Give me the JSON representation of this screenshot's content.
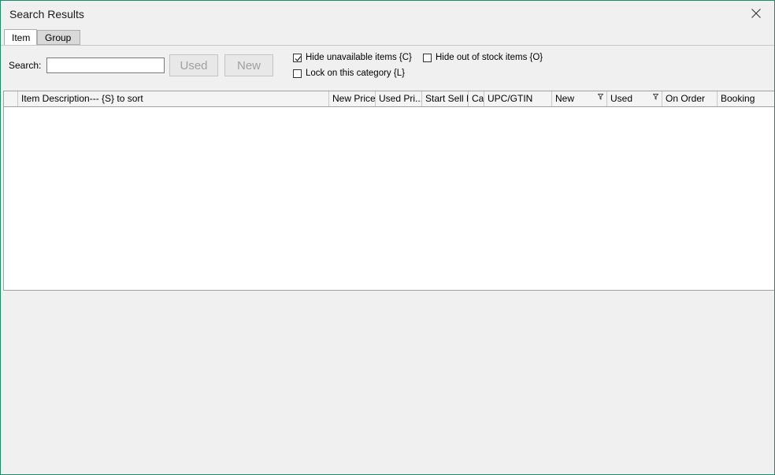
{
  "window": {
    "title": "Search Results"
  },
  "tabs": [
    {
      "label": "Item",
      "active": true
    },
    {
      "label": "Group",
      "active": false
    }
  ],
  "search": {
    "label": "Search:",
    "value": "",
    "placeholder": ""
  },
  "buttons": {
    "used": "Used",
    "new": "New"
  },
  "options": {
    "hide_unavailable": {
      "label": "Hide unavailable items {C}",
      "checked": true
    },
    "hide_out_of_stock": {
      "label": "Hide out of stock items {O}",
      "checked": false
    },
    "lock_category": {
      "label": "Lock on this category {L}",
      "checked": false
    }
  },
  "grid": {
    "columns": [
      "",
      "Item Description--- {S} to sort",
      "New Price",
      "Used Pri...",
      "Start Sell D",
      "Ca",
      "UPC/GTIN",
      "New",
      "Used",
      "On Order",
      "Booking"
    ],
    "rows": []
  }
}
